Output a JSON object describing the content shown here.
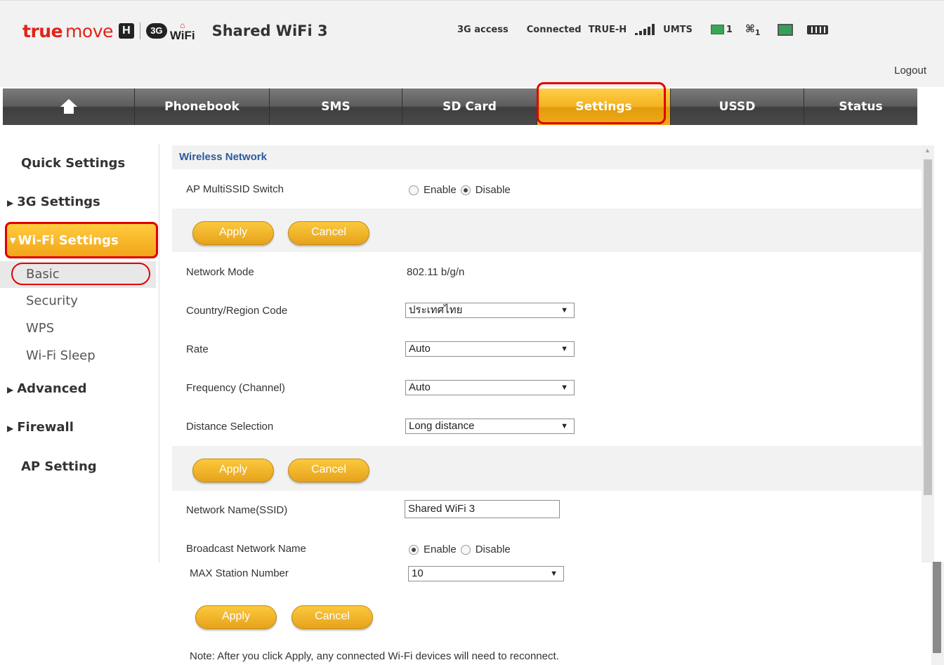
{
  "header": {
    "brand_true": "true",
    "brand_move": "move",
    "brand_h": "H",
    "brand_3g": "3G",
    "brand_wifi": "WiFi",
    "product_name": "Shared WiFi 3",
    "status": {
      "access": "3G access",
      "connection": "Connected",
      "carrier": "TRUE-H",
      "network": "UMTS",
      "sms_count": "1",
      "wifi_clients": "1"
    },
    "logout_label": "Logout",
    "icons": [
      "signal-icon",
      "envelope-icon",
      "antenna-icon",
      "monitor-icon",
      "battery-icon"
    ]
  },
  "nav": {
    "tabs": [
      {
        "label": "",
        "icon": "home-icon"
      },
      {
        "label": "Phonebook"
      },
      {
        "label": "SMS"
      },
      {
        "label": "SD Card"
      },
      {
        "label": "Settings",
        "active": true
      },
      {
        "label": "USSD"
      },
      {
        "label": "Status"
      }
    ]
  },
  "sidebar": {
    "quick_settings": "Quick Settings",
    "g3_settings": "3G Settings",
    "wifi_settings": "Wi-Fi Settings",
    "wifi_sub": [
      "Basic",
      "Security",
      "WPS",
      "Wi-Fi Sleep"
    ],
    "advanced": "Advanced",
    "firewall": "Firewall",
    "ap_setting": "AP Setting"
  },
  "content": {
    "section_title": "Wireless Network",
    "multissid": {
      "label": "AP MultiSSID Switch",
      "enable": "Enable",
      "disable": "Disable",
      "selected": "Disable"
    },
    "apply_label": "Apply",
    "cancel_label": "Cancel",
    "network_mode": {
      "label": "Network Mode",
      "value": "802.11 b/g/n"
    },
    "country": {
      "label": "Country/Region Code",
      "value": "ประเทศไทย"
    },
    "rate": {
      "label": "Rate",
      "value": "Auto"
    },
    "frequency": {
      "label": "Frequency (Channel)",
      "value": "Auto"
    },
    "distance": {
      "label": "Distance Selection",
      "value": "Long distance"
    },
    "ssid": {
      "label": "Network Name(SSID)",
      "value": "Shared WiFi 3"
    },
    "broadcast": {
      "label": "Broadcast Network Name",
      "enable": "Enable",
      "disable": "Disable",
      "selected": "Enable"
    },
    "max_station": {
      "label": "MAX Station Number",
      "value": "10"
    },
    "note": "Note: After you click Apply, any connected Wi-Fi devices will need to reconnect."
  },
  "colors": {
    "brand_red": "#e2231a",
    "accent_orange": "#f2a51a",
    "highlight_red": "#e00000",
    "section_blue": "#2b5aa0"
  }
}
